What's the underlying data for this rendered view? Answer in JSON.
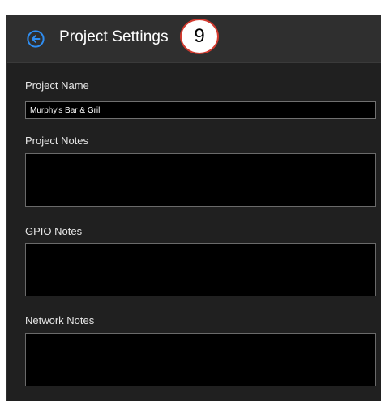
{
  "header": {
    "title": "Project Settings",
    "step_number": "9",
    "back_icon": "arrow-left-circle-icon",
    "accent_color": "#2f8ef2",
    "badge_border_color": "#d23a2f"
  },
  "fields": {
    "project_name": {
      "label": "Project Name",
      "value": "Murphy's Bar & Grill"
    },
    "project_notes": {
      "label": "Project Notes",
      "value": ""
    },
    "gpio_notes": {
      "label": "GPIO Notes",
      "value": ""
    },
    "network_notes": {
      "label": "Network Notes",
      "value": ""
    }
  }
}
